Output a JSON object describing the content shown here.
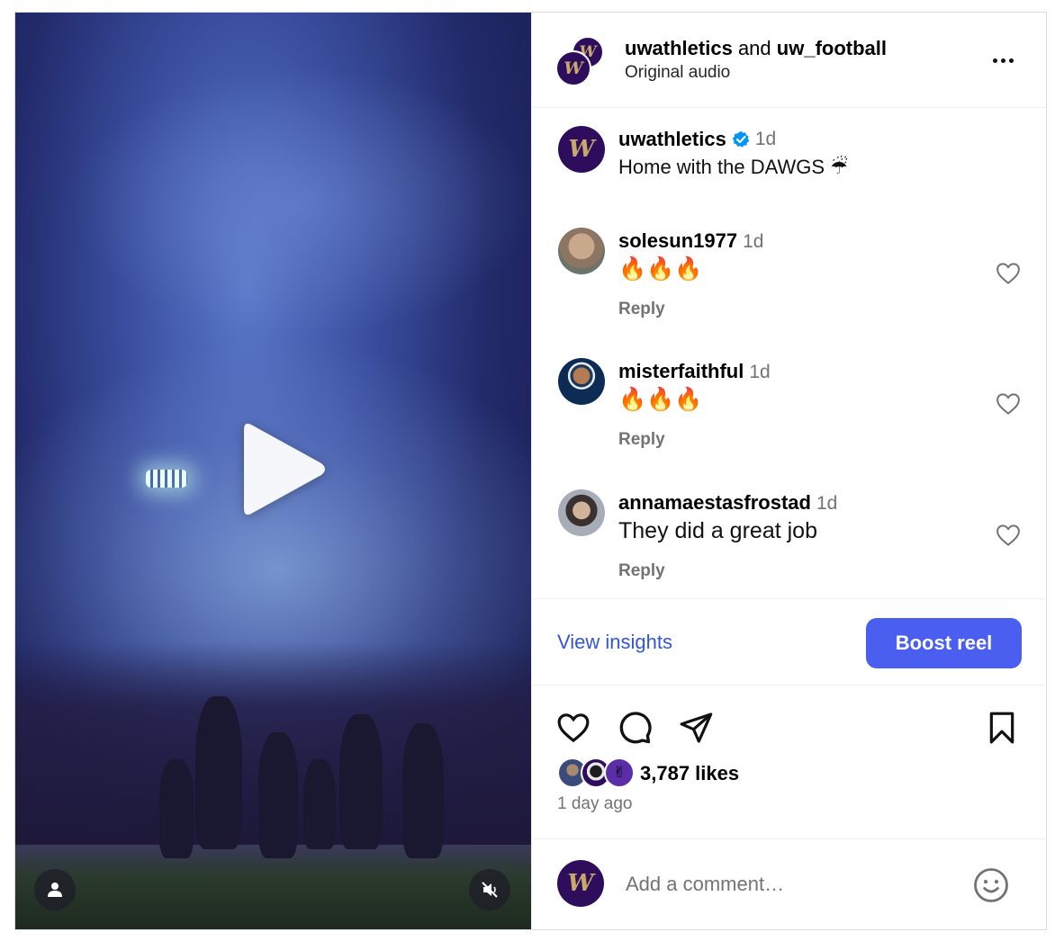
{
  "post_header": {
    "author1": "uwathletics",
    "joiner": "and",
    "author2": "uw_football",
    "audio": "Original audio",
    "avatar_letter": "W"
  },
  "caption": {
    "username": "uwathletics",
    "time": "1d",
    "text": "Home with the DAWGS ☔"
  },
  "comments": [
    {
      "username": "solesun1977",
      "time": "1d",
      "text": "🔥🔥🔥",
      "reply": "Reply"
    },
    {
      "username": "misterfaithful",
      "time": "1d",
      "text": "🔥🔥🔥",
      "reply": "Reply"
    },
    {
      "username": "annamaestasfrostad",
      "time": "1d",
      "text": "They did a great job",
      "reply": "Reply"
    }
  ],
  "insights": {
    "view_label": "View insights",
    "boost_label": "Boost reel"
  },
  "stats": {
    "likes": "3,787 likes",
    "posted": "1 day ago"
  },
  "composer": {
    "placeholder": "Add a comment…"
  },
  "colors": {
    "accent": "#4a5ef0",
    "link": "#3256d6",
    "uw_purple": "#2e0e5c",
    "uw_gold": "#c8a96a"
  }
}
